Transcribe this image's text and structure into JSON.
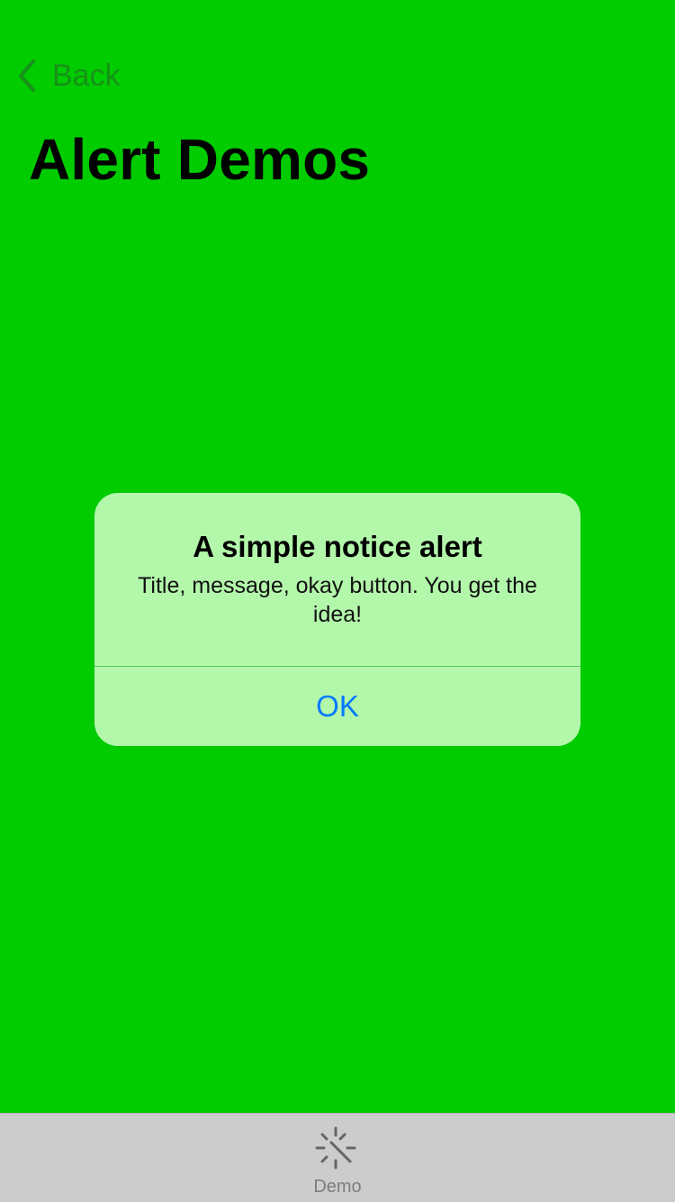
{
  "navigation": {
    "back_label": "Back",
    "back_icon": "chevron-left-icon",
    "page_title": "Alert Demos"
  },
  "alert": {
    "title": "A simple notice alert",
    "message": "Title, message, okay button. You get the idea!",
    "ok_label": "OK"
  },
  "tab_bar": {
    "items": [
      {
        "label": "Demo",
        "icon": "magic-wand-icon",
        "selected": false
      }
    ]
  },
  "colors": {
    "background": "#00cc00",
    "alert_background": "#b3f7ab",
    "button_blue": "#007aff",
    "tab_bar_background": "#cccccc"
  }
}
